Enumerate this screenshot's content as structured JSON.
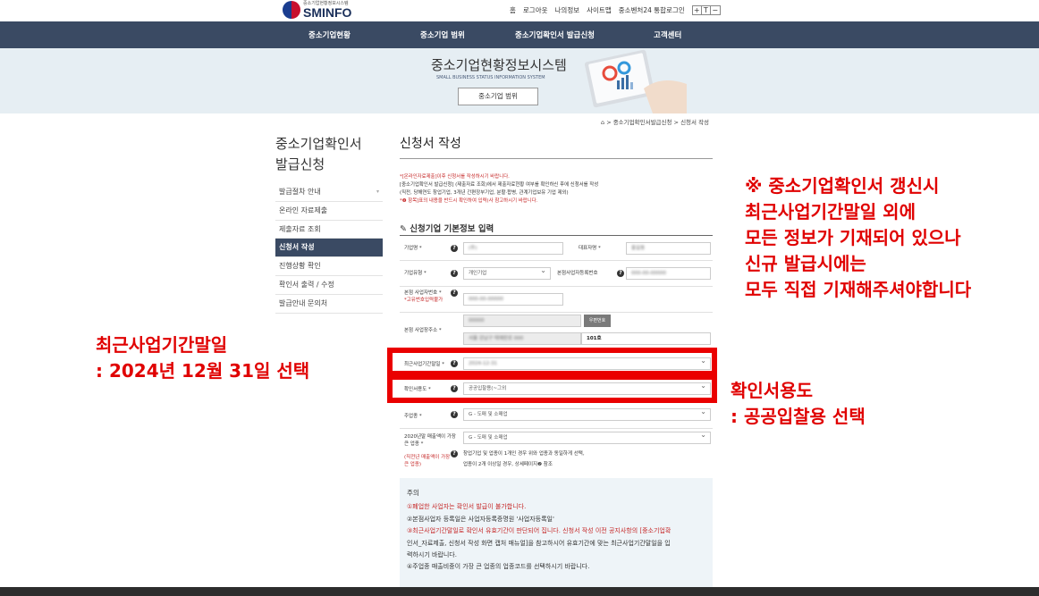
{
  "topbar": {
    "logo_sub": "중소기업현황정보시스템",
    "logo_name": "SMINFO",
    "links": [
      "홈",
      "로그아웃",
      "나의정보",
      "사이트맵",
      "중소벤처24 통합로그인"
    ],
    "font_sizes": [
      "+",
      "T",
      "−"
    ]
  },
  "nav": {
    "items": [
      "중소기업현황",
      "중소기업 범위",
      "중소기업확인서 발급신청",
      "고객센터"
    ]
  },
  "banner": {
    "title": "중소기업현황정보시스템",
    "subtitle": "SMALL BUSINESS STATUS INFORMATION SYSTEM",
    "button": "중소기업 범위"
  },
  "breadcrumb": "⌂ > 중소기업확인서발급신청 > 신청서 작성",
  "sidebar": {
    "title_line1": "중소기업확인서",
    "title_line2": "발급신청",
    "items": [
      {
        "label": "발급절차 안내",
        "chev": "▾"
      },
      {
        "label": "온라인 자료제출",
        "chev": ""
      },
      {
        "label": "제출자료 조회",
        "chev": ""
      },
      {
        "label": "신청서 작성",
        "chev": ""
      },
      {
        "label": "진행상황 확인",
        "chev": ""
      },
      {
        "label": "확인서 출력 / 수정",
        "chev": ""
      },
      {
        "label": "발급안내 문의처",
        "chev": ""
      }
    ]
  },
  "page": {
    "title": "신청서 작성",
    "notes": [
      "*[온라인자료제출]이후 신청서를 작성하시기 바랍니다.",
      "[중소기업확인서 발급신청] (제출자료 조회)에서 제출자료현황 여부를 확인하신 후에 신청서를 작성",
      "(직전, 당해연도 창업기업, 3개년 간편장부기업, 분할·합병, 관계기업보유 기업 제외)",
      "*❷ 항목]표의 내용을 반드시 확인하여 입력(사 참고하시기 바랍니다."
    ],
    "section_title": "신청기업 기본정보 입력"
  },
  "form": {
    "company_name_label": "기업명 *",
    "company_name_value": "(주)",
    "ceo_label": "대표자명 *",
    "ceo_value": "홍길동",
    "company_type_label": "기업유형 *",
    "company_type_value": "개인기업",
    "bizno_label": "본점사업자등록번호",
    "bizno_value": "000-00-00000",
    "corpno_label": "본점 사업자번호 *",
    "corpno_sub": "*고유번호입력불가",
    "corpno_value": "000-00-00000",
    "address_label": "본점 사업장주소 *",
    "address_zip": "00000",
    "address_zip_button": "우편번호",
    "address_main": "서울 강남구 테헤란로 000",
    "address_detail": "101호",
    "last_period_label": "최근사업기간말일 *",
    "last_period_value": "2024-12-31",
    "purpose_label": "확인서용도 *",
    "purpose_value": "공공입찰용(~그외",
    "industry_label": "주업종 *",
    "industry_value": "G - 도매 및 소매업",
    "max_sales_label": "2020년말 매출액이 가장 큰 업종 *",
    "max_sales_value": "G - 도매 및 소매업",
    "hint_label": "(직전년 매출액이 가장 큰 업종)",
    "hint_text1": "창업기업 및 업종이 1개인 경우 위와 업종과 동일하게 선택,",
    "hint_text2": "업종이 2개 이상일 경우, 상세페이지❷ 참조"
  },
  "caution": {
    "title": "주의",
    "items": [
      "①폐업한 사업자는 확인서 발급이 불가합니다.",
      "②본점사업자 등록일은 사업자등록증명원 '사업자등록일'",
      "③최근사업기간말일로 확인서 유효기간이 판단되어 집니다. 신청서 작성 이전 공지사항의 [중소기업확",
      "인서_자료제출, 신청서 작성 화면 캡처 매뉴얼]을 참고하시어 유효기간에 맞는 최근사업기간말일을 입",
      "력하시기 바랍니다.",
      "④주업종 매출비중이 가장 큰 업종의 업종코드를 선택하시기 바랍니다."
    ]
  },
  "annotations": {
    "top_right": [
      "※ 중소기업확인서 갱신시",
      "최근사업기간말일 외에",
      "모든 정보가 기재되어 있으나",
      "신규 발급시에는",
      "모두 직접 기재해주셔야합니다"
    ],
    "left": [
      "최근사업기간말일",
      ": 2024년 12월 31일 선택"
    ],
    "right": [
      "확인서용도",
      ": 공공입찰용 선택"
    ],
    "color": "#e00000"
  }
}
